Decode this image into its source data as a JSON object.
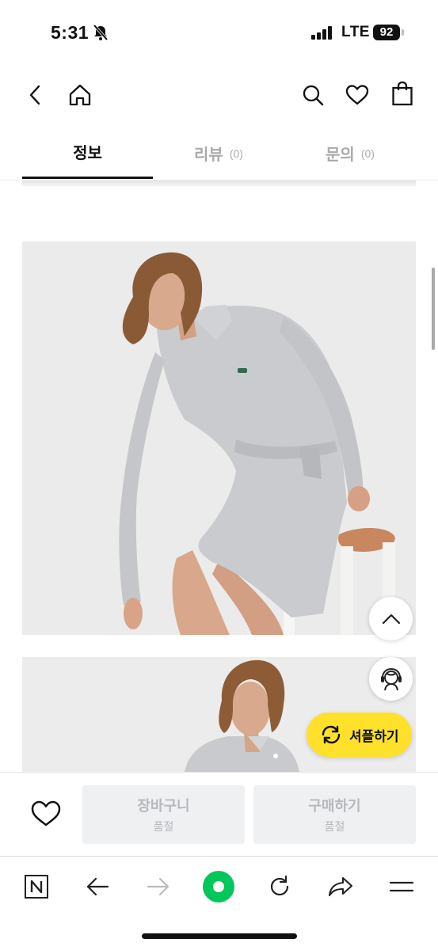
{
  "status_bar": {
    "time": "5:31",
    "network": "LTE",
    "battery": "92"
  },
  "header": {
    "back_icon": "chevron-left-icon",
    "home_icon": "home-icon",
    "search_icon": "search-icon",
    "wishlist_icon": "heart-icon",
    "cart_icon": "shopping-bag-icon"
  },
  "tabs": [
    {
      "label": "정보",
      "count": ""
    },
    {
      "label": "리뷰",
      "count": "(0)"
    },
    {
      "label": "문의",
      "count": "(0)"
    }
  ],
  "floating": {
    "scroll_top_icon": "chevron-up-icon",
    "support_icon": "headset-agent-icon",
    "shuffle_icon": "refresh-arrows-icon",
    "shuffle_label": "셔플하기"
  },
  "buy_bar": {
    "like_icon": "heart-icon",
    "cart_label": "장바구니",
    "cart_sub": "품절",
    "buy_label": "구매하기",
    "buy_sub": "품절"
  },
  "browser_toolbar": {
    "items": [
      "naver-n-icon",
      "arrow-left-icon",
      "arrow-right-icon",
      "green-dot-icon",
      "reload-icon",
      "share-icon",
      "menu-icon"
    ]
  },
  "colors": {
    "accent_yellow": "#ffe12b",
    "naver_green": "#03c75a",
    "disabled_gray": "#eef0f2"
  }
}
